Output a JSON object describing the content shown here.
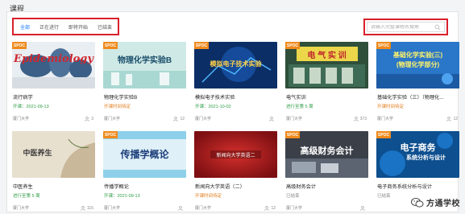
{
  "page_title": "课程",
  "tabs": [
    {
      "label": "全部",
      "active": true
    },
    {
      "label": "正在进行",
      "active": false
    },
    {
      "label": "即将开始",
      "active": false
    },
    {
      "label": "已结束",
      "active": false
    }
  ],
  "search": {
    "placeholder": "请输入完整课程名搜索"
  },
  "badge_label": "SPOC",
  "courses": [
    {
      "name": "流行病学",
      "status": "开课：2021-09-13",
      "status_color": "green",
      "school": "厦门大学",
      "learners": "3",
      "thumb_text": "Epidemiology",
      "has_badge": true
    },
    {
      "name": "物理化学实验B",
      "status": "开课时间待定",
      "status_color": "orange",
      "school": "厦门大学",
      "learners": "12",
      "thumb_text": "物理化学实验B",
      "has_badge": true
    },
    {
      "name": "模拟电子技术实验",
      "status": "开课：2021-10-02",
      "status_color": "green",
      "school": "厦门大学",
      "learners": "",
      "thumb_text": "模拟电子技术实验",
      "has_badge": true
    },
    {
      "name": "电气实训",
      "status": "进行至第 5 周",
      "status_color": "green",
      "school": "厦门大学",
      "learners": "373",
      "thumb_text": "电 气 实 训",
      "has_badge": true
    },
    {
      "name": "基础化学实验（三）（物理化...",
      "status": "开课时间待定",
      "status_color": "orange",
      "school": "厦门大学",
      "learners": "12",
      "thumb_text": "基础化学实验(三)",
      "thumb_text_2": "(物理化学部分)",
      "has_badge": true
    },
    {
      "name": "中医养生",
      "status": "进行至第 5 周",
      "status_color": "green",
      "school": "厦门大学",
      "learners": "115",
      "thumb_text": "中医养生",
      "has_badge": false
    },
    {
      "name": "传播学概论",
      "status": "开课：2021-09-13",
      "status_color": "green",
      "school": "厦门大学",
      "learners": "",
      "thumb_text": "传播学概论",
      "has_badge": true
    },
    {
      "name": "新闻向大学英语（二）",
      "status": "开课时间待定",
      "status_color": "orange",
      "school": "厦门大学",
      "learners": "12",
      "thumb_text": "新闻向大学英语二",
      "has_badge": false
    },
    {
      "name": "高级财务会计",
      "status": "已结束",
      "status_color": "gray",
      "school": "厦门大学",
      "learners": "",
      "thumb_text": "高级财务会计",
      "has_badge": true
    },
    {
      "name": "电子商务系统分析与设计",
      "status": "已结束",
      "status_color": "gray",
      "school": "厦门大学",
      "learners": "",
      "thumb_text": "电子商务",
      "thumb_text_2": "系统分析与设计",
      "has_badge": true
    }
  ],
  "watermark": {
    "text": "方通学校"
  }
}
